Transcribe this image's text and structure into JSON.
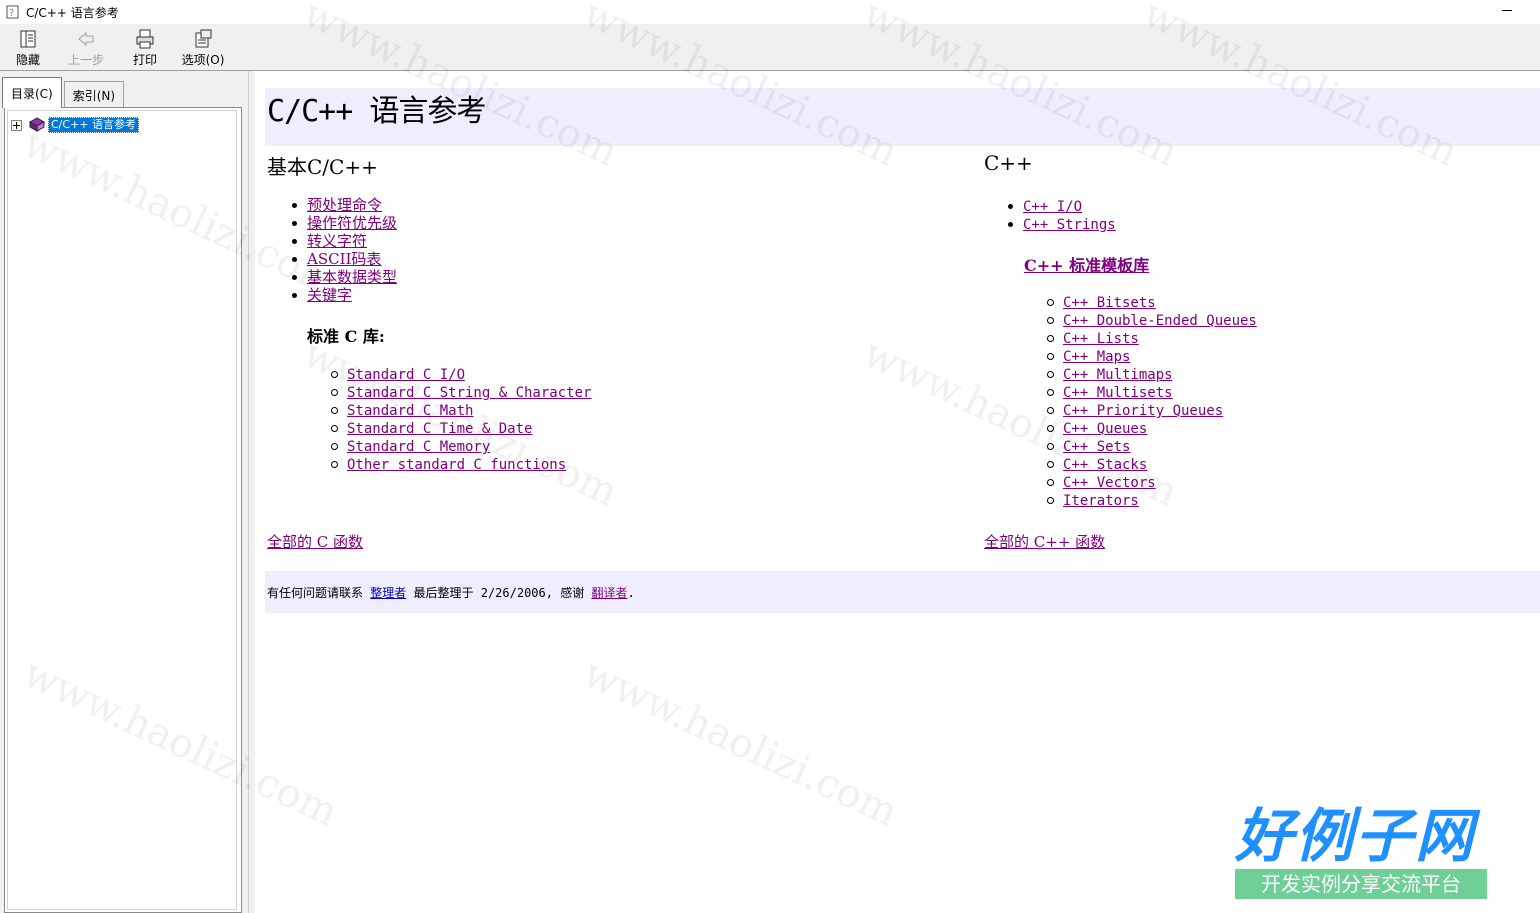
{
  "window": {
    "title": "C/C++ 语言参考"
  },
  "toolbar": {
    "hide_label": "隐藏",
    "back_label": "上一步",
    "print_label": "打印",
    "options_label": "选项(O)"
  },
  "left_tabs": {
    "contents_label": "目录(C)",
    "index_label": "索引(N)"
  },
  "tree": {
    "root_label": "C/C++ 语言参考"
  },
  "content": {
    "title": "C/C++ 语言参考",
    "left_col": {
      "heading": "基本C/C++",
      "links": [
        "预处理命令",
        "操作符优先级",
        "转义字符",
        "ASCII码表",
        "基本数据类型",
        "关键字"
      ],
      "std_c_heading": "标准 C 库:",
      "std_c_links": [
        "Standard C I/O",
        "Standard C String & Character",
        "Standard C Math",
        "Standard C Time & Date",
        "Standard C Memory",
        "Other standard C functions"
      ],
      "all_link": "全部的 C 函数"
    },
    "right_col": {
      "heading": "C++",
      "links": [
        "C++ I/O",
        "C++ Strings"
      ],
      "stl_heading": "C++ 标准模板库",
      "stl_links": [
        "C++ Bitsets",
        "C++ Double-Ended Queues",
        "C++ Lists",
        "C++ Maps",
        "C++ Multimaps",
        "C++ Multisets",
        "C++ Priority Queues",
        "C++ Queues",
        "C++ Sets",
        "C++ Stacks",
        "C++ Vectors",
        "Iterators"
      ],
      "all_link": "全部的 C++ 函数"
    },
    "footer": {
      "prefix": "有任何问题请联系",
      "organizer_link": "整理者",
      "middle": "最后整理于 2/26/2006, 感谢",
      "translator_link": "翻译者",
      "suffix": "."
    }
  },
  "watermark": {
    "text": "www.haolizi.com"
  },
  "brand": {
    "name": "好例子网",
    "slogan": "开发实例分享交流平台"
  }
}
